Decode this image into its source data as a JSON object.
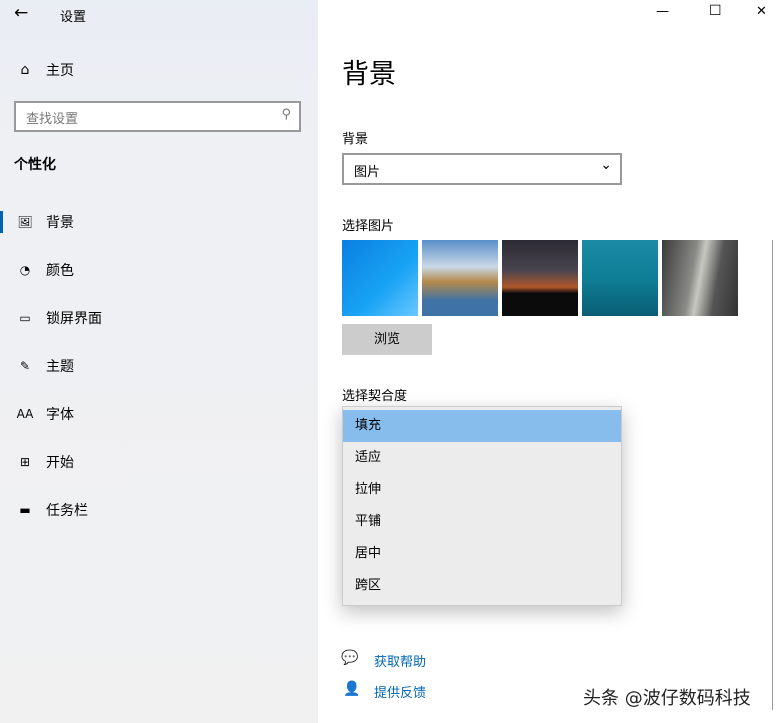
{
  "window": {
    "title": "设置",
    "minimize": "—",
    "maximize": "☐",
    "close": "✕"
  },
  "sidebar": {
    "home": "主页",
    "search_placeholder": "查找设置",
    "section": "个性化",
    "items": [
      {
        "label": "背景",
        "icon": "image-icon",
        "glyph": "🖼"
      },
      {
        "label": "颜色",
        "icon": "palette-icon",
        "glyph": "◔"
      },
      {
        "label": "锁屏界面",
        "icon": "lockscreen-icon",
        "glyph": "▭"
      },
      {
        "label": "主题",
        "icon": "theme-icon",
        "glyph": "✎"
      },
      {
        "label": "字体",
        "icon": "font-icon",
        "glyph": "AA"
      },
      {
        "label": "开始",
        "icon": "start-icon",
        "glyph": "⊞"
      },
      {
        "label": "任务栏",
        "icon": "taskbar-icon",
        "glyph": "▬"
      }
    ]
  },
  "main": {
    "title": "背景",
    "bg_label": "背景",
    "bg_value": "图片",
    "choose_picture": "选择图片",
    "browse": "浏览",
    "fit_label": "选择契合度",
    "fit_options": [
      "填充",
      "适应",
      "拉伸",
      "平铺",
      "居中",
      "跨区"
    ],
    "help": "获取帮助",
    "feedback": "提供反馈"
  },
  "watermark": "头条 @波仔数码科技",
  "colors": {
    "accent": "#0063b1",
    "highlight": "#86bdec",
    "link": "#0066b4"
  }
}
